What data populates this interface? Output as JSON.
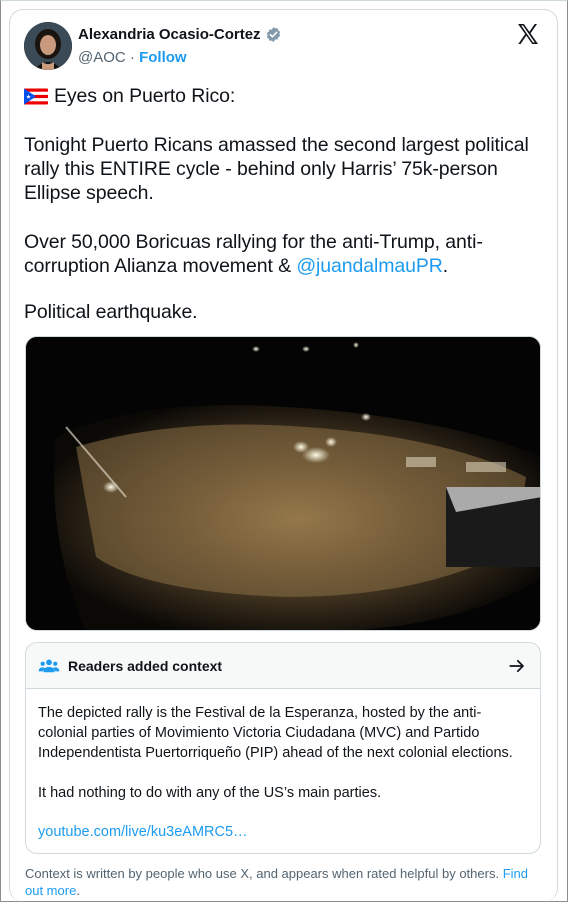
{
  "author": {
    "name": "Alexandria Ocasio-Cortez",
    "handle": "@AOC",
    "separator": "·",
    "follow_label": "Follow"
  },
  "post": {
    "line1": "Eyes on Puerto Rico:",
    "p2": "Tonight Puerto Ricans amassed the second largest political rally this ENTIRE cycle - behind only Harris’ 75k-person Ellipse speech.",
    "p3_pre": "Over 50,000 Boricuas rallying for the anti-Trump, anti-corruption Alianza movement & ",
    "p3_mention": "@juandalmauPR",
    "p3_post": ".",
    "p4": "Political earthquake."
  },
  "context_note": {
    "title": "Readers added context",
    "body1": "The depicted rally is the Festival de la Esperanza, hosted by the anti-colonial parties of Movimiento Victoria Ciudadana (MVC) and Partido Independentista Puertorriqueño (PIP) ahead of the next colonial elections.",
    "body2": "It had nothing to do with any of the US’s main parties.",
    "link": "youtube.com/live/ku3eAMRC5…"
  },
  "footer": {
    "text": "Context is written by people who use X, and appears when rated helpful by others. ",
    "find_more": "Find out more",
    "end": "."
  },
  "icons": {
    "verified": "verified-badge-icon",
    "x_logo": "x-logo-icon",
    "flag": "puerto-rico-flag-icon",
    "people": "people-icon",
    "arrow": "arrow-right-icon"
  },
  "colors": {
    "link": "#1d9bf0",
    "text": "#0f1419",
    "muted": "#536471",
    "border": "#cfd9de"
  }
}
